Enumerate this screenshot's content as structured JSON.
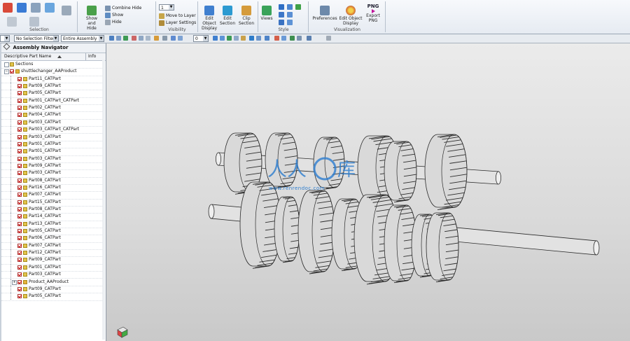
{
  "ribbon": {
    "groups": [
      {
        "label": "Selection",
        "buttons": []
      },
      {
        "label": "",
        "buttons": [
          {
            "label": "Show and Hide"
          },
          {
            "label": "Hide"
          },
          {
            "label": "Show"
          }
        ],
        "rows": [
          "Combine Hide",
          "Show",
          "Hide"
        ]
      },
      {
        "label": "Visibility",
        "buttons": [
          {
            "label": "Move to Layer"
          },
          {
            "label": "Layer Settings"
          }
        ]
      },
      {
        "label": "",
        "buttons": [
          {
            "label": "Edit Object Display"
          },
          {
            "label": "Edit Section"
          },
          {
            "label": "Clip Section"
          }
        ]
      },
      {
        "label": "Style",
        "buttons": [
          {
            "label": "Views"
          }
        ]
      },
      {
        "label": "Visualization",
        "buttons": [
          {
            "label": "Preferences"
          },
          {
            "label": "Edit Object Display"
          },
          {
            "label": "Export PNG"
          }
        ]
      }
    ],
    "layer_value": "1",
    "png_label": "PNG"
  },
  "toolbar": {
    "filter": "No Selection Filter",
    "scope": "Entire Assembly",
    "snap_value": "0"
  },
  "navigator": {
    "title": "Assembly Navigator",
    "columns": [
      "Descriptive Part Name",
      "Info"
    ],
    "section_label": "Sections",
    "root": "shuttlechanger_AAProduct",
    "items": [
      "Part11_CATPart",
      "Part09_CATPart",
      "Part05_CATPart",
      "Part01_CATPart_CATPart",
      "Part02_CATPart",
      "Part04_CATPart",
      "Part03_CATPart",
      "Part03_CATPart_CATPart",
      "Part03_CATPart",
      "Part01_CATPart",
      "Part01_CATPart",
      "Part03_CATPart",
      "Part09_CATPart",
      "Part03_CATPart",
      "Part08_CATPart",
      "Part16_CATPart",
      "Part07_CATPart",
      "Part15_CATPart",
      "Part08_CATPart",
      "Part14_CATPart",
      "Part13_CATPart",
      "Part05_CATPart",
      "Part06_CATPart",
      "Part07_CATPart",
      "Part12_CATPart",
      "Part09_CATPart",
      "Part01_CATPart",
      "Part03_CATPart",
      "Product_AAProduct",
      "Part09_CATPart",
      "Part05_CATPart"
    ]
  },
  "viewport": {
    "watermark_text": "www.renrendoc.com",
    "colors": {
      "part": "#d9d9d9",
      "edge": "#2b2b2b",
      "background_top": "#ebebeb",
      "background_bottom": "#c9c9c9"
    }
  }
}
